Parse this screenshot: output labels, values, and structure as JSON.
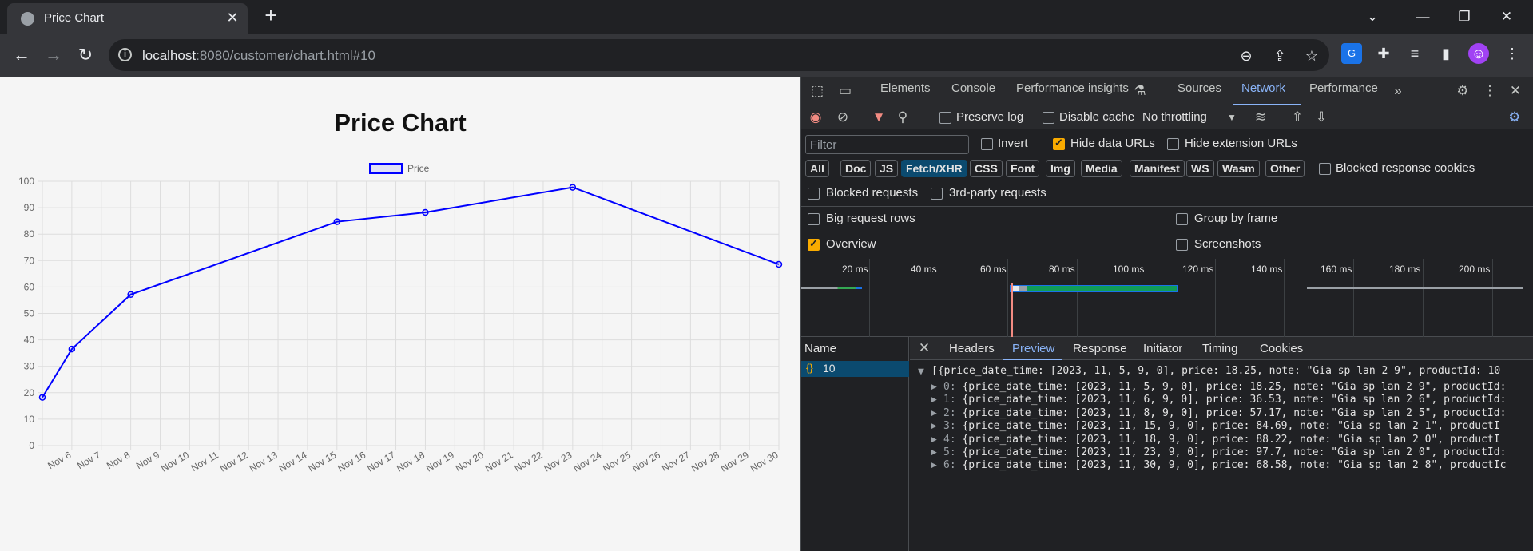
{
  "browser": {
    "tab_title": "Price Chart",
    "url_host": "localhost",
    "url_rest": ":8080/customer/chart.html#10"
  },
  "page": {
    "chart_title": "Price Chart"
  },
  "chart_data": {
    "type": "line",
    "title": "Price Chart",
    "legend": "Price",
    "legend_position": "top-center",
    "x_ticks": [
      "Nov 6",
      "Nov 7",
      "Nov 8",
      "Nov 9",
      "Nov 10",
      "Nov 11",
      "Nov 12",
      "Nov 13",
      "Nov 14",
      "Nov 15",
      "Nov 16",
      "Nov 17",
      "Nov 18",
      "Nov 19",
      "Nov 20",
      "Nov 21",
      "Nov 22",
      "Nov 23",
      "Nov 24",
      "Nov 25",
      "Nov 26",
      "Nov 27",
      "Nov 28",
      "Nov 29",
      "Nov 30"
    ],
    "y_ticks": [
      "0",
      "10",
      "20",
      "30",
      "40",
      "50",
      "60",
      "70",
      "80",
      "90",
      "100"
    ],
    "ylim": [
      0,
      100
    ],
    "xlim": [
      "2023-11-05",
      "2023-11-30"
    ],
    "grid": true,
    "color": "#0000ff",
    "series": [
      {
        "name": "Price",
        "x": [
          "2023-11-05",
          "2023-11-06",
          "2023-11-08",
          "2023-11-15",
          "2023-11-18",
          "2023-11-23",
          "2023-11-30"
        ],
        "values": [
          18.25,
          36.53,
          57.17,
          84.69,
          88.22,
          97.7,
          68.58
        ]
      }
    ]
  },
  "devtools": {
    "tabs": [
      "Elements",
      "Console",
      "Performance insights",
      "Sources",
      "Network",
      "Performance"
    ],
    "active_tab": "Network",
    "preserve_log": "Preserve log",
    "disable_cache": "Disable cache",
    "throttling": "No throttling",
    "filter_placeholder": "Filter",
    "invert": "Invert",
    "hide_data_urls": "Hide data URLs",
    "hide_extension_urls": "Hide extension URLs",
    "chips": [
      "All",
      "Doc",
      "JS",
      "Fetch/XHR",
      "CSS",
      "Font",
      "Img",
      "Media",
      "Manifest",
      "WS",
      "Wasm",
      "Other"
    ],
    "active_chip": "Fetch/XHR",
    "blocked_response_cookies": "Blocked response cookies",
    "blocked_requests": "Blocked requests",
    "third_party": "3rd-party requests",
    "big_rows": "Big request rows",
    "group_by_frame": "Group by frame",
    "overview": "Overview",
    "screenshots": "Screenshots",
    "timeline_labels": [
      "20 ms",
      "40 ms",
      "60 ms",
      "80 ms",
      "100 ms",
      "120 ms",
      "140 ms",
      "160 ms",
      "180 ms",
      "200 ms"
    ],
    "name_header": "Name",
    "request_name": "10",
    "detail_tabs": [
      "Headers",
      "Preview",
      "Response",
      "Initiator",
      "Timing",
      "Cookies"
    ],
    "active_detail_tab": "Preview",
    "preview_header": "[{price_date_time: [2023, 11, 5, 9, 0], price: 18.25, note: \"Gia sp lan 2 9\", productId: 10",
    "preview_rows": [
      {
        "idx": "0",
        "text": "{price_date_time: [2023, 11, 5, 9, 0], price: 18.25, note: \"Gia sp lan 2 9\", productId:"
      },
      {
        "idx": "1",
        "text": "{price_date_time: [2023, 11, 6, 9, 0], price: 36.53, note: \"Gia sp lan 2 6\", productId:"
      },
      {
        "idx": "2",
        "text": "{price_date_time: [2023, 11, 8, 9, 0], price: 57.17, note: \"Gia sp lan 2 5\", productId:"
      },
      {
        "idx": "3",
        "text": "{price_date_time: [2023, 11, 15, 9, 0], price: 84.69, note: \"Gia sp lan 2 1\", productI"
      },
      {
        "idx": "4",
        "text": "{price_date_time: [2023, 11, 18, 9, 0], price: 88.22, note: \"Gia sp lan 2 0\", productI"
      },
      {
        "idx": "5",
        "text": "{price_date_time: [2023, 11, 23, 9, 0], price: 97.7, note: \"Gia sp lan 2 0\", productId:"
      },
      {
        "idx": "6",
        "text": "{price_date_time: [2023, 11, 30, 9, 0], price: 68.58, note: \"Gia sp lan 2 8\", productIc"
      }
    ]
  }
}
